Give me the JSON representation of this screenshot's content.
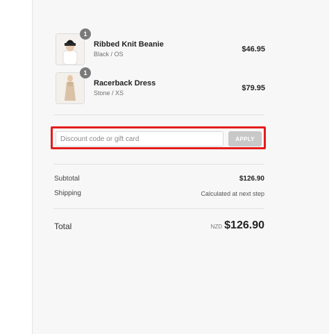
{
  "cart": {
    "items": [
      {
        "name": "Ribbed Knit Beanie",
        "variant": "Black / OS",
        "price": "$46.95",
        "quantity": "1",
        "image": "beanie-photo"
      },
      {
        "name": "Racerback Dress",
        "variant": "Stone / XS",
        "price": "$79.95",
        "quantity": "1",
        "image": "dress-photo"
      }
    ]
  },
  "discount": {
    "placeholder": "Discount code or gift card",
    "value": "",
    "apply_label": "APPLY",
    "highlight_color": "#e41b1b"
  },
  "totals": {
    "subtotal_label": "Subtotal",
    "subtotal_value": "$126.90",
    "shipping_label": "Shipping",
    "shipping_value": "Calculated at next step",
    "total_label": "Total",
    "currency": "NZD",
    "total_value": "$126.90"
  }
}
